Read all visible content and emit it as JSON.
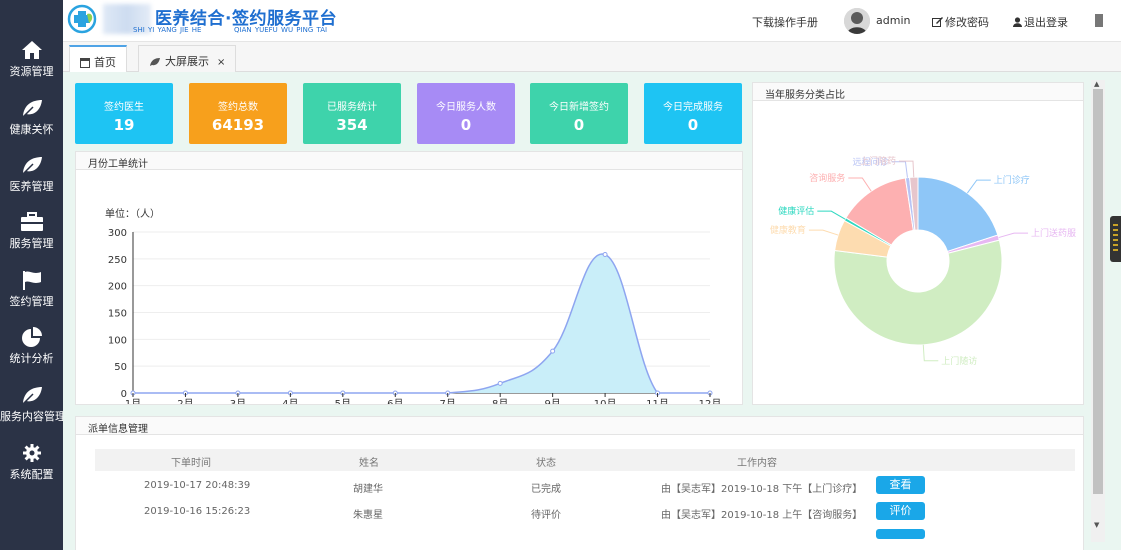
{
  "app": {
    "title": "医养结合·签约服务平台",
    "pinyin_left": "SHI YI YANG JIE HE",
    "pinyin_right": "QIAN YUEFU WU PING TAI"
  },
  "header": {
    "manual": "下载操作手册",
    "user": "admin",
    "change_password": "修改密码",
    "logout": "退出登录"
  },
  "sidebar": {
    "items": [
      {
        "label": "资源管理",
        "icon": "home-icon"
      },
      {
        "label": "健康关怀",
        "icon": "leaf-icon"
      },
      {
        "label": "医养管理",
        "icon": "leaf-icon"
      },
      {
        "label": "服务管理",
        "icon": "briefcase-icon"
      },
      {
        "label": "签约管理",
        "icon": "flag-icon"
      },
      {
        "label": "统计分析",
        "icon": "pie-chart-icon"
      },
      {
        "label": "服务内容管理",
        "icon": "leaf-icon"
      },
      {
        "label": "系统配置",
        "icon": "gear-icon"
      }
    ]
  },
  "tabs": [
    {
      "label": "首页",
      "closable": false
    },
    {
      "label": "大屏展示",
      "closable": true,
      "close_glyph": "×"
    }
  ],
  "stats": [
    {
      "title": "签约医生",
      "value": "19",
      "color": "#1ec4f3"
    },
    {
      "title": "签约总数",
      "value": "64193",
      "color": "#f7a01c"
    },
    {
      "title": "已服务统计",
      "value": "354",
      "color": "#3ed3ab"
    },
    {
      "title": "今日服务人数",
      "value": "0",
      "color": "#a78bf5"
    },
    {
      "title": "今日新增签约",
      "value": "0",
      "color": "#3ed3ab"
    },
    {
      "title": "今日完成服务",
      "value": "0",
      "color": "#1ec4f3"
    }
  ],
  "line_panel": {
    "title": "月份工单统计",
    "unit": "单位：（人）"
  },
  "pie_panel": {
    "title": "当年服务分类占比"
  },
  "table_panel": {
    "title": "派单信息管理",
    "headers": [
      "下单时间",
      "姓名",
      "状态",
      "工作内容"
    ],
    "rows": [
      {
        "time": "2019-10-17 20:48:39",
        "name": "胡建华",
        "status": "已完成",
        "content": "由【吴志军】2019-10-18 下午【上门诊疗】",
        "action": "查看"
      },
      {
        "time": "2019-10-16 15:26:23",
        "name": "朱惠星",
        "status": "待评价",
        "content": "由【吴志军】2019-10-18 上午【咨询服务】",
        "action": "评价"
      }
    ]
  },
  "chart_data": [
    {
      "type": "area",
      "title": "月份工单统计",
      "ylabel": "单位：（人）",
      "categories": [
        "1月",
        "2月",
        "3月",
        "4月",
        "5月",
        "6月",
        "7月",
        "8月",
        "9月",
        "10月",
        "11月",
        "12月"
      ],
      "values": [
        0,
        0,
        0,
        0,
        0,
        0,
        0,
        18,
        78,
        258,
        0,
        0
      ],
      "ylim": [
        0,
        300
      ],
      "yticks": [
        0,
        50,
        100,
        150,
        200,
        250,
        300
      ],
      "grid": true,
      "colors": {
        "line": "#8ea5f0",
        "fill": "#c9eef9"
      }
    },
    {
      "type": "pie",
      "title": "当年服务分类占比",
      "donut": true,
      "slices": [
        {
          "label": "上门诊疗",
          "value": 20,
          "color": "#8ec6f7"
        },
        {
          "label": "上门送药服",
          "value": 1,
          "color": "#e7b8f2"
        },
        {
          "label": "上门随访",
          "value": 56,
          "color": "#d0edc2"
        },
        {
          "label": "健康教育",
          "value": 6,
          "color": "#fddcb0"
        },
        {
          "label": "健康评估",
          "value": 0.6,
          "color": "#2ed8c0"
        },
        {
          "label": "咨询服务",
          "value": 14,
          "color": "#fdb0b1"
        },
        {
          "label": "远程问诊",
          "value": 0.8,
          "color": "#b8c3f4"
        },
        {
          "label": "上门陪药",
          "value": 1.6,
          "color": "#e7c6cc"
        }
      ]
    }
  ]
}
